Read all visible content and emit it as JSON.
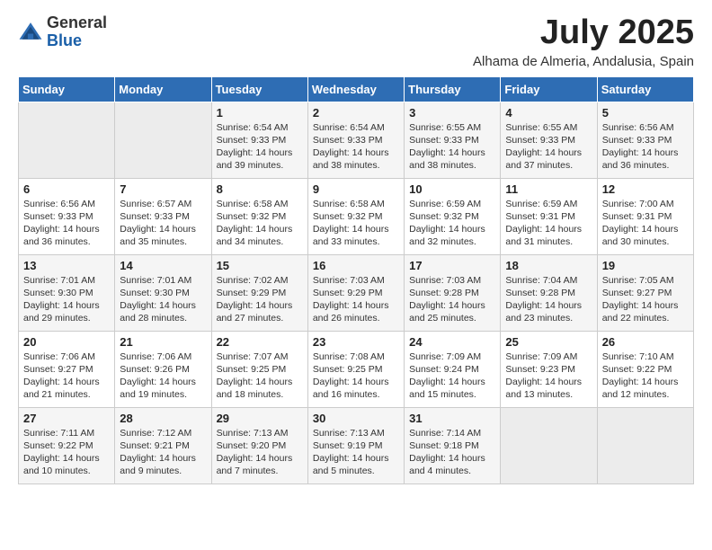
{
  "logo": {
    "general": "General",
    "blue": "Blue"
  },
  "title": "July 2025",
  "location": "Alhama de Almeria, Andalusia, Spain",
  "days_of_week": [
    "Sunday",
    "Monday",
    "Tuesday",
    "Wednesday",
    "Thursday",
    "Friday",
    "Saturday"
  ],
  "weeks": [
    [
      {
        "day": "",
        "empty": true
      },
      {
        "day": "",
        "empty": true
      },
      {
        "day": "1",
        "sunrise": "Sunrise: 6:54 AM",
        "sunset": "Sunset: 9:33 PM",
        "daylight": "Daylight: 14 hours and 39 minutes."
      },
      {
        "day": "2",
        "sunrise": "Sunrise: 6:54 AM",
        "sunset": "Sunset: 9:33 PM",
        "daylight": "Daylight: 14 hours and 38 minutes."
      },
      {
        "day": "3",
        "sunrise": "Sunrise: 6:55 AM",
        "sunset": "Sunset: 9:33 PM",
        "daylight": "Daylight: 14 hours and 38 minutes."
      },
      {
        "day": "4",
        "sunrise": "Sunrise: 6:55 AM",
        "sunset": "Sunset: 9:33 PM",
        "daylight": "Daylight: 14 hours and 37 minutes."
      },
      {
        "day": "5",
        "sunrise": "Sunrise: 6:56 AM",
        "sunset": "Sunset: 9:33 PM",
        "daylight": "Daylight: 14 hours and 36 minutes."
      }
    ],
    [
      {
        "day": "6",
        "sunrise": "Sunrise: 6:56 AM",
        "sunset": "Sunset: 9:33 PM",
        "daylight": "Daylight: 14 hours and 36 minutes."
      },
      {
        "day": "7",
        "sunrise": "Sunrise: 6:57 AM",
        "sunset": "Sunset: 9:33 PM",
        "daylight": "Daylight: 14 hours and 35 minutes."
      },
      {
        "day": "8",
        "sunrise": "Sunrise: 6:58 AM",
        "sunset": "Sunset: 9:32 PM",
        "daylight": "Daylight: 14 hours and 34 minutes."
      },
      {
        "day": "9",
        "sunrise": "Sunrise: 6:58 AM",
        "sunset": "Sunset: 9:32 PM",
        "daylight": "Daylight: 14 hours and 33 minutes."
      },
      {
        "day": "10",
        "sunrise": "Sunrise: 6:59 AM",
        "sunset": "Sunset: 9:32 PM",
        "daylight": "Daylight: 14 hours and 32 minutes."
      },
      {
        "day": "11",
        "sunrise": "Sunrise: 6:59 AM",
        "sunset": "Sunset: 9:31 PM",
        "daylight": "Daylight: 14 hours and 31 minutes."
      },
      {
        "day": "12",
        "sunrise": "Sunrise: 7:00 AM",
        "sunset": "Sunset: 9:31 PM",
        "daylight": "Daylight: 14 hours and 30 minutes."
      }
    ],
    [
      {
        "day": "13",
        "sunrise": "Sunrise: 7:01 AM",
        "sunset": "Sunset: 9:30 PM",
        "daylight": "Daylight: 14 hours and 29 minutes."
      },
      {
        "day": "14",
        "sunrise": "Sunrise: 7:01 AM",
        "sunset": "Sunset: 9:30 PM",
        "daylight": "Daylight: 14 hours and 28 minutes."
      },
      {
        "day": "15",
        "sunrise": "Sunrise: 7:02 AM",
        "sunset": "Sunset: 9:29 PM",
        "daylight": "Daylight: 14 hours and 27 minutes."
      },
      {
        "day": "16",
        "sunrise": "Sunrise: 7:03 AM",
        "sunset": "Sunset: 9:29 PM",
        "daylight": "Daylight: 14 hours and 26 minutes."
      },
      {
        "day": "17",
        "sunrise": "Sunrise: 7:03 AM",
        "sunset": "Sunset: 9:28 PM",
        "daylight": "Daylight: 14 hours and 25 minutes."
      },
      {
        "day": "18",
        "sunrise": "Sunrise: 7:04 AM",
        "sunset": "Sunset: 9:28 PM",
        "daylight": "Daylight: 14 hours and 23 minutes."
      },
      {
        "day": "19",
        "sunrise": "Sunrise: 7:05 AM",
        "sunset": "Sunset: 9:27 PM",
        "daylight": "Daylight: 14 hours and 22 minutes."
      }
    ],
    [
      {
        "day": "20",
        "sunrise": "Sunrise: 7:06 AM",
        "sunset": "Sunset: 9:27 PM",
        "daylight": "Daylight: 14 hours and 21 minutes."
      },
      {
        "day": "21",
        "sunrise": "Sunrise: 7:06 AM",
        "sunset": "Sunset: 9:26 PM",
        "daylight": "Daylight: 14 hours and 19 minutes."
      },
      {
        "day": "22",
        "sunrise": "Sunrise: 7:07 AM",
        "sunset": "Sunset: 9:25 PM",
        "daylight": "Daylight: 14 hours and 18 minutes."
      },
      {
        "day": "23",
        "sunrise": "Sunrise: 7:08 AM",
        "sunset": "Sunset: 9:25 PM",
        "daylight": "Daylight: 14 hours and 16 minutes."
      },
      {
        "day": "24",
        "sunrise": "Sunrise: 7:09 AM",
        "sunset": "Sunset: 9:24 PM",
        "daylight": "Daylight: 14 hours and 15 minutes."
      },
      {
        "day": "25",
        "sunrise": "Sunrise: 7:09 AM",
        "sunset": "Sunset: 9:23 PM",
        "daylight": "Daylight: 14 hours and 13 minutes."
      },
      {
        "day": "26",
        "sunrise": "Sunrise: 7:10 AM",
        "sunset": "Sunset: 9:22 PM",
        "daylight": "Daylight: 14 hours and 12 minutes."
      }
    ],
    [
      {
        "day": "27",
        "sunrise": "Sunrise: 7:11 AM",
        "sunset": "Sunset: 9:22 PM",
        "daylight": "Daylight: 14 hours and 10 minutes."
      },
      {
        "day": "28",
        "sunrise": "Sunrise: 7:12 AM",
        "sunset": "Sunset: 9:21 PM",
        "daylight": "Daylight: 14 hours and 9 minutes."
      },
      {
        "day": "29",
        "sunrise": "Sunrise: 7:13 AM",
        "sunset": "Sunset: 9:20 PM",
        "daylight": "Daylight: 14 hours and 7 minutes."
      },
      {
        "day": "30",
        "sunrise": "Sunrise: 7:13 AM",
        "sunset": "Sunset: 9:19 PM",
        "daylight": "Daylight: 14 hours and 5 minutes."
      },
      {
        "day": "31",
        "sunrise": "Sunrise: 7:14 AM",
        "sunset": "Sunset: 9:18 PM",
        "daylight": "Daylight: 14 hours and 4 minutes."
      },
      {
        "day": "",
        "empty": true
      },
      {
        "day": "",
        "empty": true
      }
    ]
  ]
}
